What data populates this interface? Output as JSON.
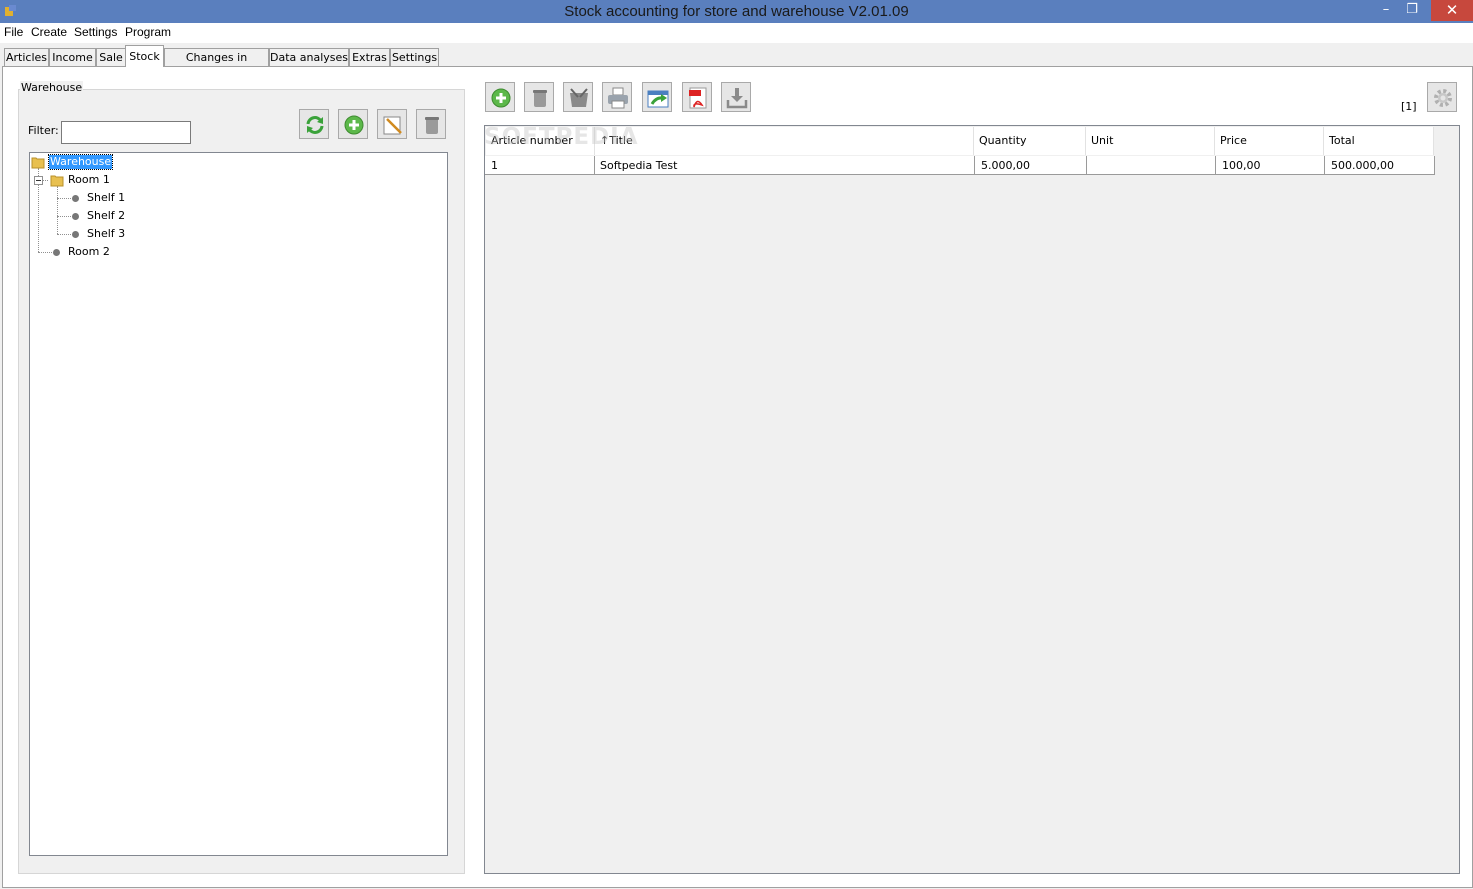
{
  "window": {
    "title": "Stock accounting for store and warehouse V2.01.09",
    "minimize": "–",
    "restore": "❐",
    "close": "✕"
  },
  "menu": [
    "File",
    "Create",
    "Settings",
    "Program"
  ],
  "tabs": [
    "Articles",
    "Income",
    "Sale",
    "Stock",
    "Changes in stocking",
    "Data analyses",
    "Extras",
    "Settings"
  ],
  "active_tab": "Stock",
  "warehouse_panel": {
    "group_label": "Warehouse",
    "filter_label": "Filter:",
    "filter_value": "",
    "buttons": [
      "refresh-icon",
      "add-icon",
      "edit-icon",
      "delete-icon"
    ],
    "tree": {
      "root": "Warehouse",
      "room1": "Room 1",
      "shelf1": "Shelf 1",
      "shelf2": "Shelf 2",
      "shelf3": "Shelf 3",
      "room2": "Room 2"
    }
  },
  "stock_toolbar": [
    "add-icon",
    "delete-icon",
    "cut-icon",
    "print-icon",
    "export-icon",
    "pdf-icon",
    "download-icon",
    "gear-icon"
  ],
  "watermark": "SOFTPEDIA",
  "page_indicator": "[1]",
  "table": {
    "columns": [
      "Article number",
      "Title",
      "Quantity",
      "Unit",
      "Price",
      "Total"
    ],
    "sort_indicator": "↑",
    "rows": [
      {
        "article_number": "1",
        "title": "Softpedia Test",
        "quantity": "5.000,00",
        "unit": "",
        "price": "100,00",
        "total": "500.000,00"
      }
    ]
  }
}
